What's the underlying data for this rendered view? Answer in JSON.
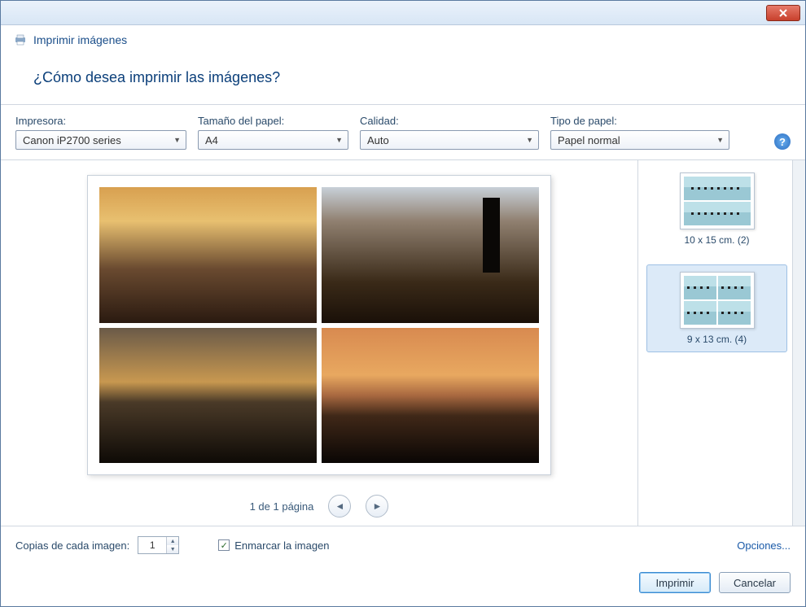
{
  "window": {
    "title": "Imprimir imágenes"
  },
  "heading": "¿Cómo desea imprimir las imágenes?",
  "options": {
    "printer": {
      "label": "Impresora:",
      "value": "Canon iP2700 series"
    },
    "paper_size": {
      "label": "Tamaño del papel:",
      "value": "A4"
    },
    "quality": {
      "label": "Calidad:",
      "value": "Auto"
    },
    "paper_type": {
      "label": "Tipo de papel:",
      "value": "Papel normal"
    }
  },
  "pager": {
    "text": "1 de 1 página"
  },
  "layouts": {
    "top_caption": "",
    "items": [
      {
        "caption": "10 x 15 cm. (2)",
        "selected": false,
        "grid": "two"
      },
      {
        "caption": "9 x 13 cm. (4)",
        "selected": true,
        "grid": "four"
      }
    ]
  },
  "bottom": {
    "copies_label": "Copias de cada imagen:",
    "copies_value": "1",
    "fit_frame_label": "Enmarcar la imagen",
    "fit_frame_checked": true,
    "options_link": "Opciones..."
  },
  "buttons": {
    "print": "Imprimir",
    "cancel": "Cancelar"
  }
}
